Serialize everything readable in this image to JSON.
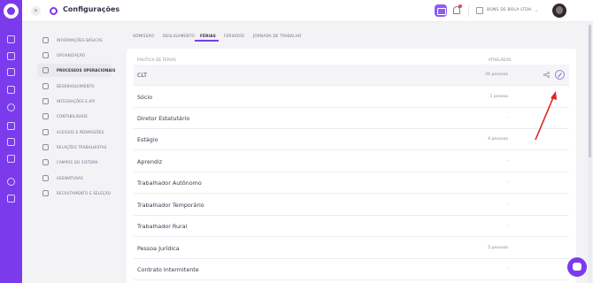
{
  "header": {
    "collapse_symbol": "»",
    "title": "Configurações",
    "company": "BONS DE BOLA LTDA.",
    "caret": "⌄"
  },
  "menu": {
    "items": [
      {
        "label": "INFORMAÇÕES BÁSICAS",
        "icon": "info-icon",
        "active": false
      },
      {
        "label": "ORGANIZAÇÃO",
        "icon": "org-icon",
        "active": false
      },
      {
        "label": "PROCESSOS OPERACIONAIS",
        "icon": "users-icon",
        "active": true
      },
      {
        "label": "DESENVOLVIMENTO",
        "icon": "rocket-icon",
        "active": false
      },
      {
        "label": "INTEGRAÇÕES E API",
        "icon": "api-icon",
        "active": false
      },
      {
        "label": "CONTABILIDADE",
        "icon": "accounting-icon",
        "active": false
      },
      {
        "label": "ACESSOS E PERMISSÕES",
        "icon": "shield-icon",
        "active": false
      },
      {
        "label": "RELAÇÕES TRABALHISTAS",
        "icon": "handshake-icon",
        "active": false
      },
      {
        "label": "CAMPOS DO SISTEMA",
        "icon": "fields-icon",
        "active": false
      },
      {
        "label": "ASSINATURAS",
        "icon": "signature-icon",
        "active": false
      },
      {
        "label": "RECRUTAMENTO E SELEÇÃO",
        "icon": "recruit-icon",
        "active": false
      }
    ]
  },
  "tabs": [
    {
      "label": "ADMISSÃO",
      "active": false
    },
    {
      "label": "DESLIGAMENTO",
      "active": false
    },
    {
      "label": "FÉRIAS",
      "active": true
    },
    {
      "label": "FERIADOS",
      "active": false
    },
    {
      "label": "JORNADA DE TRABALHO",
      "active": false
    }
  ],
  "table": {
    "headers": {
      "policy": "POLÍTICA DE FÉRIAS",
      "linked": "ATRELADOS"
    },
    "rows": [
      {
        "name": "CLT",
        "count": "26 pessoas"
      },
      {
        "name": "Sócio",
        "count": "1 pessoa"
      },
      {
        "name": "Diretor Estatutário",
        "count": "-"
      },
      {
        "name": "Estágio",
        "count": "4 pessoas"
      },
      {
        "name": "Aprendiz",
        "count": "-"
      },
      {
        "name": "Trabalhador Autônomo",
        "count": "-"
      },
      {
        "name": "Trabalhador Temporário",
        "count": "-"
      },
      {
        "name": "Trabalhador Rural",
        "count": "-"
      },
      {
        "name": "Pessoa Jurídica",
        "count": "5 pessoas"
      },
      {
        "name": "Contrato Intermitente",
        "count": "-"
      }
    ]
  },
  "colors": {
    "accent": "#7c3aed",
    "annotation_arrow": "#e02424"
  }
}
